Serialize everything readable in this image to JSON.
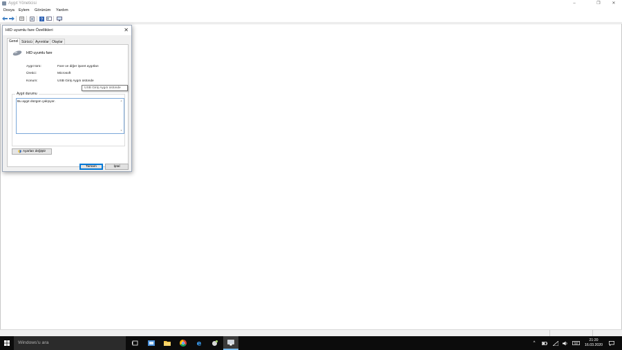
{
  "window": {
    "title": "Aygıt Yöneticisi",
    "controls": {
      "minimize": "–",
      "maximize": "❐",
      "close": "✕"
    }
  },
  "menu": [
    "Dosya",
    "Eylem",
    "Görünüm",
    "Yardım"
  ],
  "toolbar": [
    "back-icon",
    "forward-icon",
    "properties-icon",
    "update-icon",
    "help-icon",
    "view-icon",
    "monitor-icon"
  ],
  "dialog": {
    "title": "HID uyumlu fare Özellikleri",
    "close": "✕",
    "tabs": [
      "Genel",
      "Sürücü",
      "Ayrıntılar",
      "Olaylar"
    ],
    "device_name": "HID uyumlu fare",
    "rows": [
      {
        "label": "Aygıt türü:",
        "value": "Fare ve diğer işaret aygıtları"
      },
      {
        "label": "Üretici:",
        "value": "Microsoft"
      },
      {
        "label": "Konum:",
        "value": "USB Giriş Aygıtı üstünde"
      }
    ],
    "tooltip": "USB Giriş Aygıtı üstünde",
    "status_group_label": "Aygıt durumu",
    "status_text": "Bu aygıt düzgün çalışıyor.",
    "settings_button": "Ayarları değiştir",
    "ok_button": "Tamam",
    "cancel_button": "İptal"
  },
  "taskbar": {
    "search_placeholder": "Windows'u ara",
    "clock_time": "21:20",
    "clock_date": "16.03.2020",
    "accent": "#76b9ed"
  }
}
